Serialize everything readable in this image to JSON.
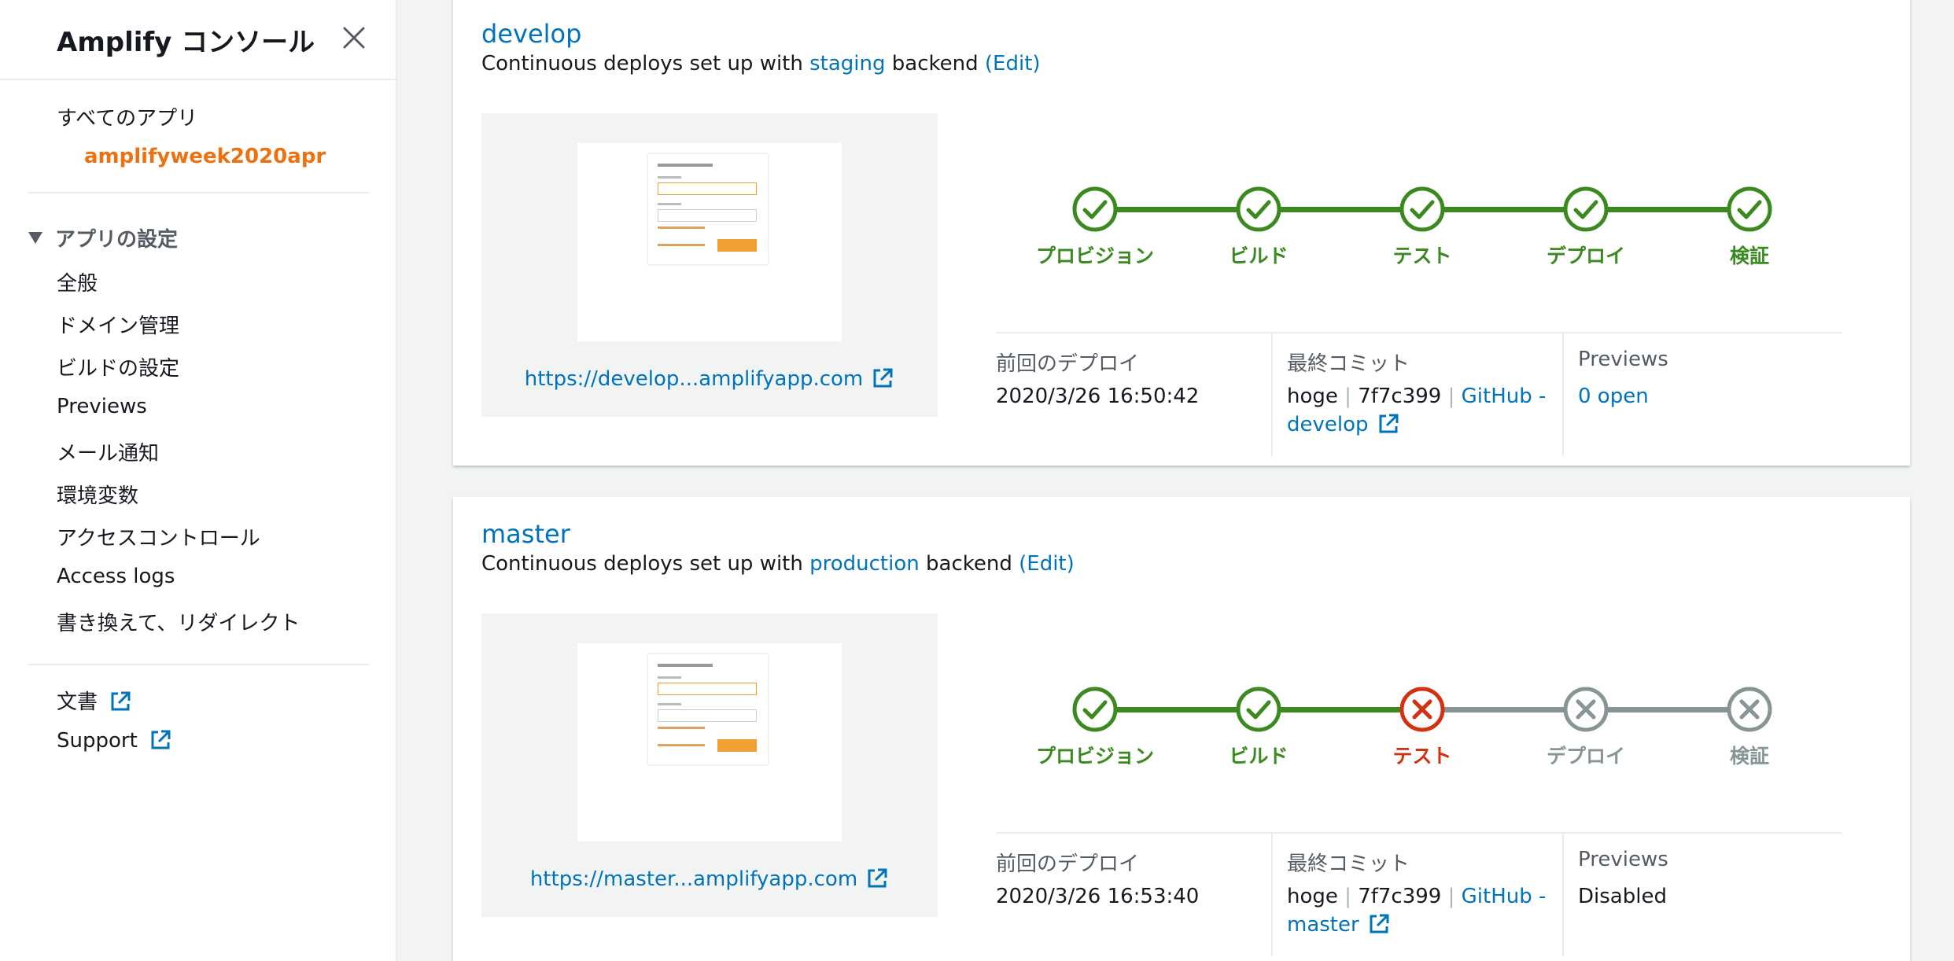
{
  "colors": {
    "success": "#3b8a1f",
    "failed": "#d13212",
    "skipped": "#879596",
    "link": "#0073bb",
    "accent": "#ec7211"
  },
  "sidebar": {
    "title": "Amplify コンソール",
    "all_apps": "すべてのアプリ",
    "app_name": "amplifyweek2020apr",
    "settings_header": "アプリの設定",
    "items": [
      "全般",
      "ドメイン管理",
      "ビルドの設定",
      "Previews",
      "メール通知",
      "環境変数",
      "アクセスコントロール",
      "Access logs",
      "書き換えて、リダイレクト"
    ],
    "docs": "文書",
    "support": "Support"
  },
  "branches": [
    {
      "name": "develop",
      "desc_prefix": "Continuous deploys set up with",
      "backend": "staging",
      "desc_mid": "backend",
      "edit": "(Edit)",
      "url": "https://develop...amplifyapp.com",
      "stages": [
        {
          "label": "プロビジョン",
          "status": "success"
        },
        {
          "label": "ビルド",
          "status": "success"
        },
        {
          "label": "テスト",
          "status": "success"
        },
        {
          "label": "デプロイ",
          "status": "success"
        },
        {
          "label": "検証",
          "status": "success"
        }
      ],
      "last_deploy_label": "前回のデプロイ",
      "last_deploy": "2020/3/26 16:50:42",
      "last_commit_label": "最終コミット",
      "commit_author": "hoge",
      "commit_sep": "|",
      "commit_hash": "7f7c399",
      "commit_repo": "GitHub -",
      "commit_branch": "develop",
      "previews_label": "Previews",
      "previews_value": "0 open"
    },
    {
      "name": "master",
      "desc_prefix": "Continuous deploys set up with",
      "backend": "production",
      "desc_mid": "backend",
      "edit": "(Edit)",
      "url": "https://master...amplifyapp.com",
      "stages": [
        {
          "label": "プロビジョン",
          "status": "success"
        },
        {
          "label": "ビルド",
          "status": "success"
        },
        {
          "label": "テスト",
          "status": "failed"
        },
        {
          "label": "デプロイ",
          "status": "skipped"
        },
        {
          "label": "検証",
          "status": "skipped"
        }
      ],
      "last_deploy_label": "前回のデプロイ",
      "last_deploy": "2020/3/26 16:53:40",
      "last_commit_label": "最終コミット",
      "commit_author": "hoge",
      "commit_sep": "|",
      "commit_hash": "7f7c399",
      "commit_repo": "GitHub -",
      "commit_branch": "master",
      "previews_label": "Previews",
      "previews_value": "Disabled"
    }
  ]
}
